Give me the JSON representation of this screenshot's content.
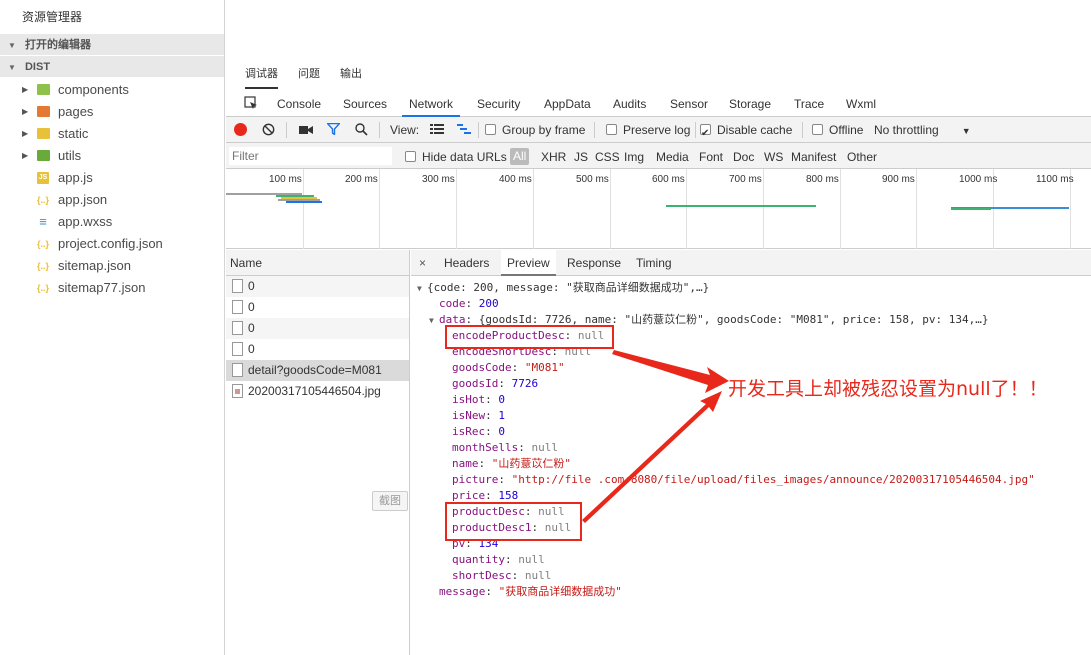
{
  "explorer": {
    "title": "资源管理器",
    "open_editors": "打开的编辑器",
    "project": "DIST",
    "folders": [
      {
        "name": "components",
        "color": "#8dc149"
      },
      {
        "name": "pages",
        "color": "#e37933"
      },
      {
        "name": "static",
        "color": "#e8c13a"
      },
      {
        "name": "utils",
        "color": "#6aaa3a"
      }
    ],
    "files": [
      {
        "name": "app.js",
        "icon": "JS",
        "color": "#e8c13a"
      },
      {
        "name": "app.json",
        "icon": "{..}",
        "color": "#e8c13a"
      },
      {
        "name": "app.wxss",
        "icon": "css-icon",
        "color": "#3b8fd6"
      },
      {
        "name": "project.config.json",
        "icon": "{..}",
        "color": "#e8c13a"
      },
      {
        "name": "sitemap.json",
        "icon": "{..}",
        "color": "#e8c13a"
      },
      {
        "name": "sitemap77.json",
        "icon": "{..}",
        "color": "#e8c13a"
      }
    ]
  },
  "top_tabs": [
    "调试器",
    "问题",
    "输出"
  ],
  "panel_tabs": [
    "Console",
    "Sources",
    "Network",
    "Security",
    "AppData",
    "Audits",
    "Sensor",
    "Storage",
    "Trace",
    "Wxml"
  ],
  "toolbar": {
    "view_label": "View:",
    "group_by_frame": "Group by frame",
    "preserve_log": "Preserve log",
    "disable_cache": "Disable cache",
    "offline": "Offline",
    "throttling": "No throttling"
  },
  "filter": {
    "placeholder": "Filter",
    "hide_data_urls": "Hide data URLs",
    "types": [
      "All",
      "XHR",
      "JS",
      "CSS",
      "Img",
      "Media",
      "Font",
      "Doc",
      "WS",
      "Manifest",
      "Other"
    ]
  },
  "overview_ticks": [
    "100 ms",
    "200 ms",
    "300 ms",
    "400 ms",
    "500 ms",
    "600 ms",
    "700 ms",
    "800 ms",
    "900 ms",
    "1000 ms",
    "1100 ms"
  ],
  "requests": {
    "header": "Name",
    "rows": [
      "0",
      "0",
      "0",
      "0",
      "detail?goodsCode=M081",
      "20200317105446504.jpg"
    ],
    "screenshot_btn": "截图"
  },
  "detail_tabs": [
    "×",
    "Headers",
    "Preview",
    "Response",
    "Timing"
  ],
  "preview": {
    "summary": "{code: 200, message: \"获取商品详细数据成功\",…}",
    "code_key": "code",
    "code_val": "200",
    "data_key": "data",
    "data_summary": "{goodsId: 7726, name: \"山药薏苡仁粉\", goodsCode: \"M081\", price: 158, pv: 134,…}",
    "fields": [
      {
        "key": "encodeProductDesc",
        "val": "null",
        "type": "null"
      },
      {
        "key": "encodeShortDesc",
        "val": "null",
        "type": "null"
      },
      {
        "key": "goodsCode",
        "val": "\"M081\"",
        "type": "str"
      },
      {
        "key": "goodsId",
        "val": "7726",
        "type": "num"
      },
      {
        "key": "isHot",
        "val": "0",
        "type": "num"
      },
      {
        "key": "isNew",
        "val": "1",
        "type": "num"
      },
      {
        "key": "isRec",
        "val": "0",
        "type": "num"
      },
      {
        "key": "monthSells",
        "val": "null",
        "type": "null"
      },
      {
        "key": "name",
        "val": "\"山药薏苡仁粉\"",
        "type": "str"
      },
      {
        "key": "picture",
        "val": "\"http://file        .com:8080/file/upload/files_images/announce/20200317105446504.jpg\"",
        "type": "str"
      },
      {
        "key": "price",
        "val": "158",
        "type": "num"
      },
      {
        "key": "productDesc",
        "val": "null",
        "type": "null"
      },
      {
        "key": "productDesc1",
        "val": "null",
        "type": "null"
      },
      {
        "key": "pv",
        "val": "134",
        "type": "num"
      },
      {
        "key": "quantity",
        "val": "null",
        "type": "null"
      },
      {
        "key": "shortDesc",
        "val": "null",
        "type": "null"
      }
    ],
    "message_key": "message",
    "message_val": "\"获取商品详细数据成功\""
  },
  "annotation": "开发工具上却被残忍设置为null了！！",
  "colors": {
    "annotation": "#e8281a",
    "accent": "#1a73e8",
    "record": "#e8281a"
  }
}
